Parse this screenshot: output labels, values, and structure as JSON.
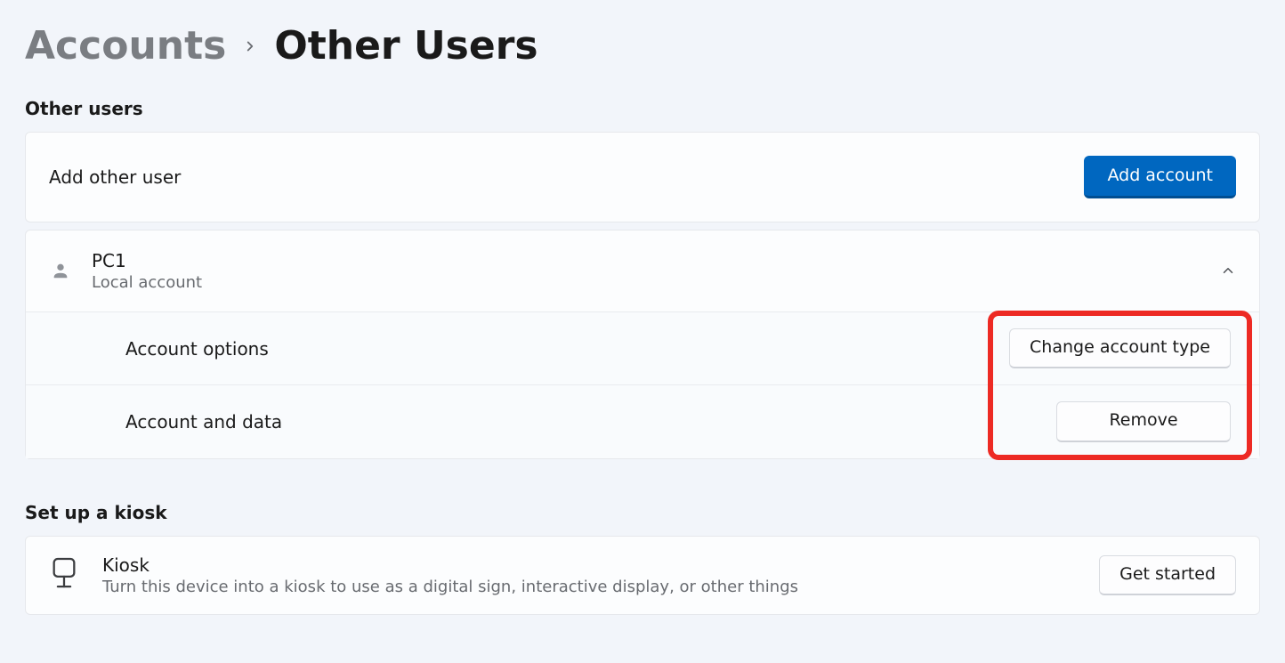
{
  "breadcrumb": {
    "parent": "Accounts",
    "current": "Other Users"
  },
  "sections": {
    "other_users_label": "Other users",
    "kiosk_label": "Set up a kiosk"
  },
  "add_row": {
    "label": "Add other user",
    "button": "Add account"
  },
  "user": {
    "name": "PC1",
    "type": "Local account",
    "options_label": "Account options",
    "change_type_button": "Change account type",
    "data_label": "Account and data",
    "remove_button": "Remove"
  },
  "kiosk": {
    "title": "Kiosk",
    "desc": "Turn this device into a kiosk to use as a digital sign, interactive display, or other things",
    "button": "Get started"
  }
}
